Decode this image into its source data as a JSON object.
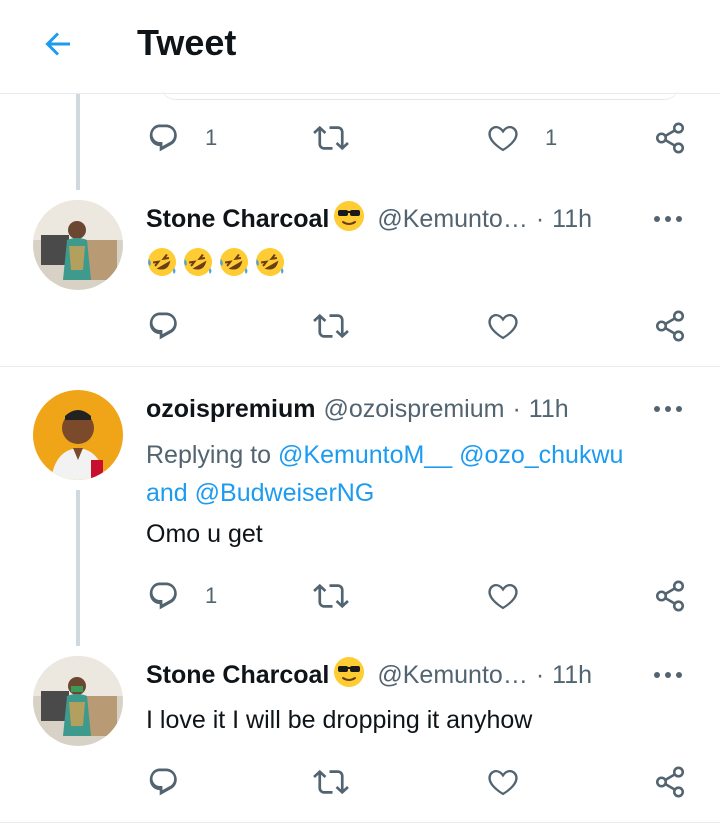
{
  "header": {
    "title": "Tweet",
    "back_icon": "arrow-left-icon"
  },
  "colors": {
    "accent": "#1d9bf0",
    "muted": "#536471",
    "text": "#0f1419",
    "divider": "#e6ecf0",
    "thread_line": "#cfd9de"
  },
  "top_actions": {
    "reply_count": "1",
    "like_count": "1"
  },
  "tweets": [
    {
      "name": "Stone Charcoal",
      "name_emoji": "sunglasses-face-emoji",
      "handle": "@Kemunto…",
      "separator": "·",
      "time": "11h",
      "body_emojis": [
        "rolling-on-floor-laughing-emoji",
        "rolling-on-floor-laughing-emoji",
        "rolling-on-floor-laughing-emoji",
        "rolling-on-floor-laughing-emoji"
      ],
      "reply_count": "",
      "like_count": ""
    },
    {
      "name": "ozoispremium",
      "handle": "@ozoispremium",
      "separator": "·",
      "time": "11h",
      "replying_prefix": "Replying to",
      "mention_1": "@KemuntoM__",
      "mention_2": "@ozo_chukwu",
      "replying_and": "and",
      "mention_3": "@BudweiserNG",
      "text": "Omo u get",
      "reply_count": "1",
      "like_count": ""
    },
    {
      "name": "Stone Charcoal",
      "name_emoji": "sunglasses-face-emoji",
      "handle": "@Kemunto…",
      "separator": "·",
      "time": "11h",
      "text": "I love it I will be dropping it anyhow",
      "reply_count": "",
      "like_count": ""
    }
  ]
}
